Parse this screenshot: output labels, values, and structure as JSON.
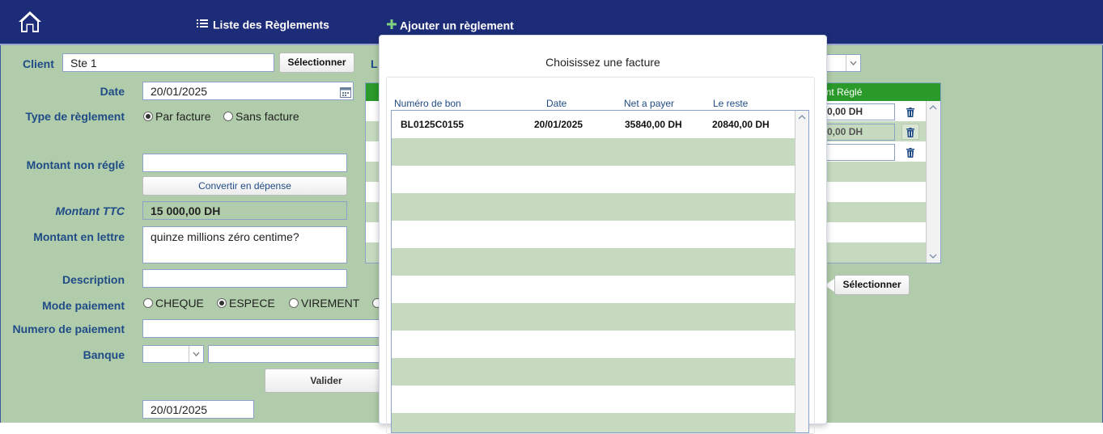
{
  "nav": {
    "list_label": "Liste des Règlements",
    "add_label": "Ajouter un règlement"
  },
  "form": {
    "client_label": "Client",
    "client_value": "Ste 1",
    "select_client_button": "Sélectionner",
    "hidden_label_initial": "L",
    "date_label": "Date",
    "date_value": "20/01/2025",
    "type_label": "Type de règlement",
    "type_options": [
      "Par facture",
      "Sans facture"
    ],
    "type_selected": "Par facture",
    "non_regle_label": "Montant non réglé",
    "non_regle_value": "",
    "convert_button": "Convertir en dépense",
    "ttc_label": "Montant TTC",
    "ttc_value": "15 000,00 DH",
    "lettre_label": "Montant en lettre",
    "lettre_value": "quinze millions zéro centime?",
    "description_label": "Description",
    "description_value": "",
    "mode_label": "Mode paiement",
    "mode_options": [
      "CHEQUE",
      "ESPECE",
      "VIREMENT"
    ],
    "mode_selected": "ESPECE",
    "numero_label": "Numero de paiement",
    "numero_value": "",
    "banque_label": "Banque",
    "valider_button": "Valider",
    "bottom_date_value": "20/01/2025"
  },
  "background_table": {
    "header_visible": "ant Réglé",
    "amounts": [
      "0,00 DH",
      "0,00 DH",
      ""
    ]
  },
  "background_select_button": "Sélectionner",
  "popup": {
    "title": "Choisissez une facture",
    "columns": [
      "Numéro  de bon",
      "Date",
      "Net a payer",
      "Le reste"
    ],
    "rows": [
      {
        "bon": "BL0125C0155",
        "date": "20/01/2025",
        "net": "35840,00 DH",
        "reste": "20840,00 DH"
      }
    ]
  },
  "colors": {
    "topbar": "#1d2c78",
    "content_bg": "#b1ccaa",
    "label_blue": "#1f4b87",
    "table_header_green": "#2a9a2a",
    "row_alt_green": "#c6dac0"
  },
  "icons": [
    "home-icon",
    "list-icon",
    "plus-icon",
    "trash-icon",
    "calendar-icon",
    "chevron-down-icon"
  ]
}
